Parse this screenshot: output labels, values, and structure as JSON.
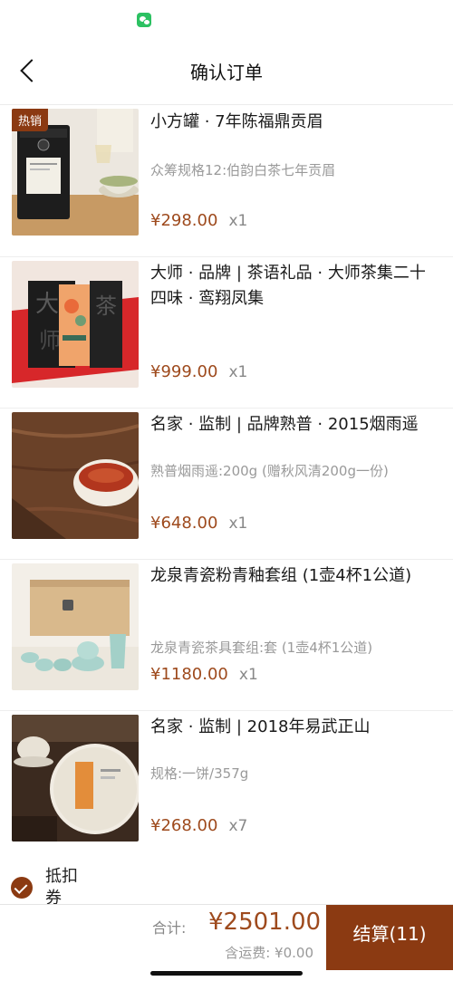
{
  "header": {
    "title": "确认订单"
  },
  "products": [
    {
      "name": "小方罐 · 7年陈福鼎贡眉",
      "spec": "众筹规格12:伯韵白茶七年贡眉",
      "price": "¥298.00",
      "qty": "x1",
      "badge": "热销"
    },
    {
      "name": "大师 · 品牌 | 茶语礼品 · 大师茶集二十四味 · 鸾翔凤集",
      "spec": "",
      "price": "¥999.00",
      "qty": "x1"
    },
    {
      "name": "名家 · 监制 | 品牌熟普 · 2015烟雨遥",
      "spec": "熟普烟雨遥:200g (赠秋风清200g一份)",
      "price": "¥648.00",
      "qty": "x1"
    },
    {
      "name": "龙泉青瓷粉青釉套组 (1壶4杯1公道)",
      "spec": "龙泉青瓷茶具套组:套 (1壶4杯1公道)",
      "price": "¥1180.00",
      "qty": "x1"
    },
    {
      "name": "名家 · 监制 | 2018年易武正山",
      "spec": "规格:一饼/357g",
      "price": "¥268.00",
      "qty": "x7"
    }
  ],
  "coupon": {
    "label": "抵扣券"
  },
  "footer": {
    "total_label": "合计:",
    "total_value": "¥2501.00",
    "shipping": "含运费: ¥0.00",
    "checkout_label": "结算(11)"
  },
  "colors": {
    "accent": "#8b3a12",
    "price": "#9e4a1d"
  },
  "icons": {
    "back": "chevron-left-icon",
    "status": "wechat-icon",
    "coupon": "check-circle-icon"
  }
}
